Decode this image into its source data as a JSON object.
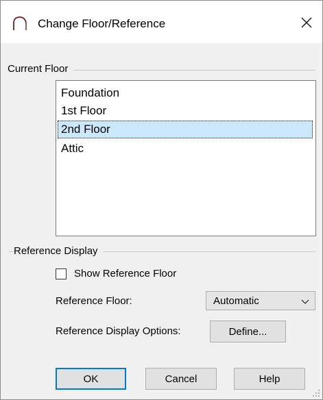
{
  "window": {
    "title": "Change Floor/Reference",
    "icon": "arch-icon",
    "close_glyph": "close-icon"
  },
  "current_floor": {
    "label": "Current Floor",
    "items": [
      {
        "label": "Foundation",
        "selected": false
      },
      {
        "label": "1st Floor",
        "selected": false
      },
      {
        "label": "2nd Floor",
        "selected": true
      },
      {
        "label": "Attic",
        "selected": false
      }
    ]
  },
  "reference_display": {
    "label": "Reference Display",
    "show_reference": {
      "label": "Show Reference Floor",
      "checked": false
    },
    "reference_floor": {
      "label": "Reference Floor:",
      "value": "Automatic"
    },
    "display_options": {
      "label": "Reference Display Options:",
      "button": "Define..."
    }
  },
  "buttons": {
    "ok": "OK",
    "cancel": "Cancel",
    "help": "Help"
  },
  "colors": {
    "selection": "#cce8ff",
    "default_button_border": "#0078d7",
    "dialog_bg": "#f0f0f0"
  }
}
